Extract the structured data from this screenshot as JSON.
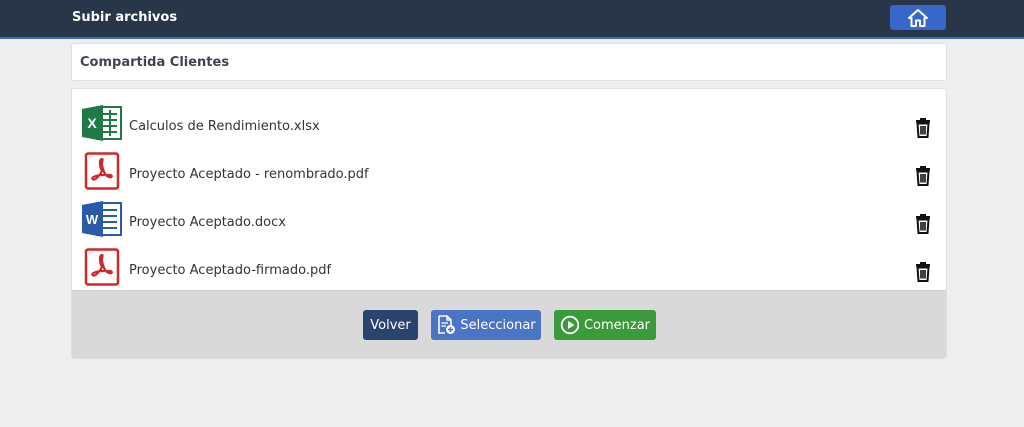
{
  "header": {
    "title": "Subir archivos",
    "home_icon": "home-icon"
  },
  "folder": {
    "name": "Compartida Clientes"
  },
  "files": [
    {
      "name": "Calculos de Rendimiento.xlsx",
      "type": "excel",
      "icon": "excel-file-icon"
    },
    {
      "name": "Proyecto Aceptado - renombrado.pdf",
      "type": "pdf",
      "icon": "pdf-file-icon"
    },
    {
      "name": "Proyecto Aceptado.docx",
      "type": "word",
      "icon": "word-file-icon"
    },
    {
      "name": "Proyecto Aceptado-firmado.pdf",
      "type": "pdf",
      "icon": "pdf-file-icon"
    }
  ],
  "buttons": {
    "back_label": "Volver",
    "select_label": "Seleccionar",
    "start_label": "Comenzar"
  },
  "colors": {
    "header_bg": "#293548",
    "accent_blue": "#3867c9",
    "back_button": "#2a4470",
    "select_button": "#4a74c4",
    "start_button": "#3a9a3c",
    "excel_green": "#1f7a45",
    "pdf_red": "#d0282b",
    "word_blue": "#2b5aa8"
  }
}
